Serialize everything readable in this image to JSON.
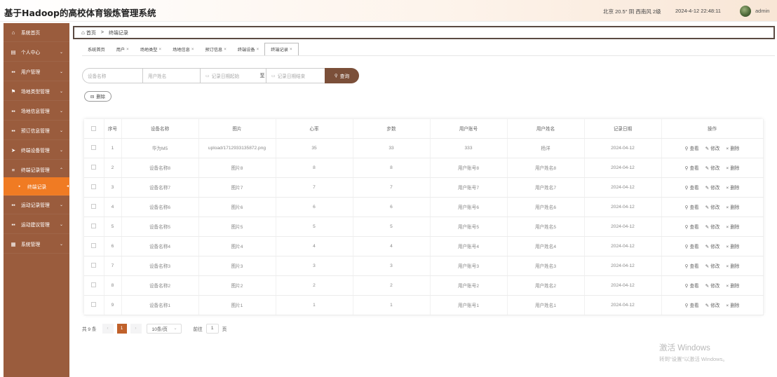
{
  "header": {
    "title": "基于Hadoop的高校体育锻炼管理系统",
    "weather": "北京  20.5°  阴  西南风  2级",
    "weather_icon": "cloud-icon",
    "datetime": "2024-4-12 22:48:11",
    "username": "admin"
  },
  "sidebar": {
    "items": [
      {
        "label": "系统首页",
        "icon": "home-icon",
        "glyph": "⌂",
        "arrow": ""
      },
      {
        "label": "个人中心",
        "icon": "window-icon",
        "glyph": "▤",
        "arrow": "⌄"
      },
      {
        "label": "用户管理",
        "icon": "grid-icon",
        "glyph": "▪▪",
        "arrow": "⌄"
      },
      {
        "label": "场地类型管理",
        "icon": "flag-icon",
        "glyph": "⚑",
        "arrow": "⌄"
      },
      {
        "label": "场地信息管理",
        "icon": "grid-icon",
        "glyph": "▪▪",
        "arrow": "⌄"
      },
      {
        "label": "预订信息管理",
        "icon": "grid-icon",
        "glyph": "▪▪",
        "arrow": "⌄"
      },
      {
        "label": "终端设备管理",
        "icon": "send-icon",
        "glyph": "➤",
        "arrow": "⌄"
      },
      {
        "label": "终端记录管理",
        "icon": "list-icon",
        "glyph": "≡",
        "arrow": "⌃"
      },
      {
        "label": "终端记录",
        "icon": "triangle-icon",
        "glyph": "▸",
        "arrow": "◂"
      },
      {
        "label": "运动记录管理",
        "icon": "grid-icon",
        "glyph": "▪▪",
        "arrow": "⌄"
      },
      {
        "label": "运动建议管理",
        "icon": "grid-icon",
        "glyph": "▪▪",
        "arrow": "⌄"
      },
      {
        "label": "系统管理",
        "icon": "table-icon",
        "glyph": "▦",
        "arrow": "⌄"
      }
    ]
  },
  "breadcrumb": {
    "home": "首页",
    "separator": ">",
    "current": "终端记录"
  },
  "tabs": [
    {
      "label": "系统首页",
      "close": ""
    },
    {
      "label": "用户",
      "close": "×"
    },
    {
      "label": "场地类型",
      "close": "×"
    },
    {
      "label": "场地信息",
      "close": "×"
    },
    {
      "label": "预订信息",
      "close": "×"
    },
    {
      "label": "终端设备",
      "close": "×"
    },
    {
      "label": "终端记录",
      "close": "×"
    }
  ],
  "search": {
    "device_placeholder": "设备名称",
    "user_placeholder": "用户姓名",
    "date_start_placeholder": "记录日期起始",
    "date_to": "至",
    "date_end_placeholder": "记录日期结束",
    "query_label": "查询"
  },
  "actions": {
    "delete_label": "删除"
  },
  "table": {
    "columns": [
      "序号",
      "设备名称",
      "图片",
      "心率",
      "步数",
      "用户账号",
      "用户姓名",
      "记录日期",
      "操作"
    ],
    "ops": {
      "view": "查看",
      "edit": "修改",
      "delete": "删除"
    },
    "rows": [
      {
        "no": "1",
        "device": "华为M5",
        "image": "upload/1712933135872.png",
        "heart": "35",
        "steps": "33",
        "account": "333",
        "name": "杨洋",
        "date": "2024-04-12"
      },
      {
        "no": "2",
        "device": "设备名称8",
        "image": "图片8",
        "heart": "8",
        "steps": "8",
        "account": "用户账号8",
        "name": "用户姓名8",
        "date": "2024-04-12"
      },
      {
        "no": "3",
        "device": "设备名称7",
        "image": "图片7",
        "heart": "7",
        "steps": "7",
        "account": "用户账号7",
        "name": "用户姓名7",
        "date": "2024-04-12"
      },
      {
        "no": "4",
        "device": "设备名称6",
        "image": "图片6",
        "heart": "6",
        "steps": "6",
        "account": "用户账号6",
        "name": "用户姓名6",
        "date": "2024-04-12"
      },
      {
        "no": "5",
        "device": "设备名称5",
        "image": "图片5",
        "heart": "5",
        "steps": "5",
        "account": "用户账号5",
        "name": "用户姓名5",
        "date": "2024-04-12"
      },
      {
        "no": "6",
        "device": "设备名称4",
        "image": "图片4",
        "heart": "4",
        "steps": "4",
        "account": "用户账号4",
        "name": "用户姓名4",
        "date": "2024-04-12"
      },
      {
        "no": "7",
        "device": "设备名称3",
        "image": "图片3",
        "heart": "3",
        "steps": "3",
        "account": "用户账号3",
        "name": "用户姓名3",
        "date": "2024-04-12"
      },
      {
        "no": "8",
        "device": "设备名称2",
        "image": "图片2",
        "heart": "2",
        "steps": "2",
        "account": "用户账号2",
        "name": "用户姓名2",
        "date": "2024-04-12"
      },
      {
        "no": "9",
        "device": "设备名称1",
        "image": "图片1",
        "heart": "1",
        "steps": "1",
        "account": "用户账号1",
        "name": "用户姓名1",
        "date": "2024-04-12"
      }
    ]
  },
  "pagination": {
    "total": "共 9 条",
    "prev": "‹",
    "current": "1",
    "next": "›",
    "page_size": "10条/页",
    "goto_label": "前往",
    "goto_value": "1",
    "goto_suffix": "页"
  },
  "watermark": {
    "title": "激活 Windows",
    "subtitle": "转到\"设置\"以激活 Windows。"
  },
  "colors": {
    "sidebar_bg": "#9a5c3d",
    "sidebar_active": "#f07b23",
    "query_button": "#7b4f39",
    "page_current": "#c0612b"
  }
}
